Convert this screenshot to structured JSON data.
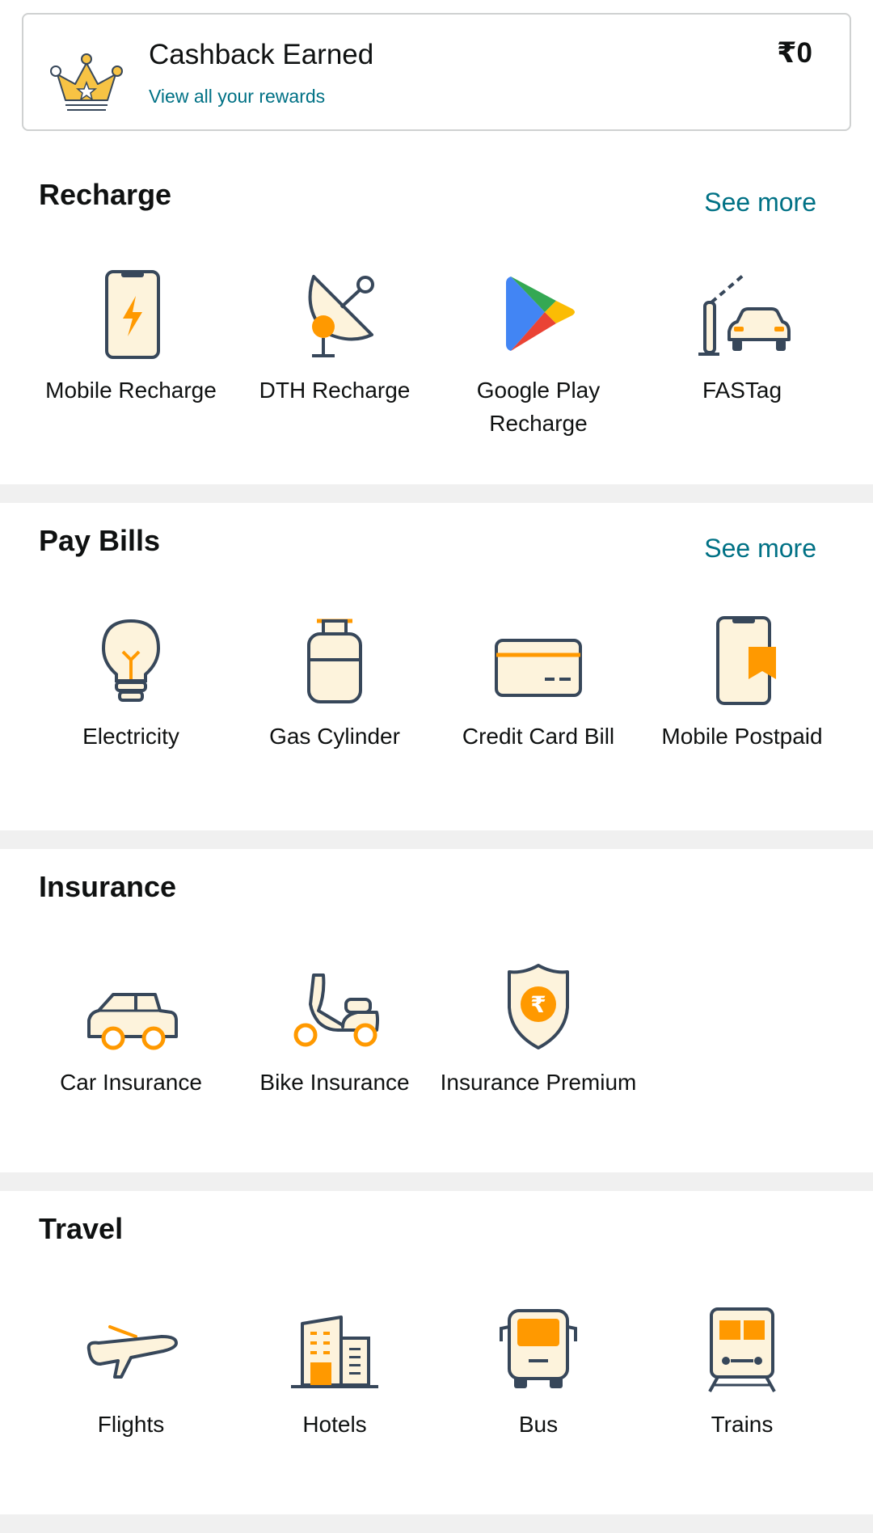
{
  "cashback": {
    "title": "Cashback Earned",
    "link": "View all your rewards",
    "amount": "₹0"
  },
  "recharge": {
    "title": "Recharge",
    "see_more": "See more",
    "items": [
      {
        "label": "Mobile Recharge",
        "icon": "mobile-recharge-icon"
      },
      {
        "label": "DTH Recharge",
        "icon": "satellite-dish-icon"
      },
      {
        "label": "Google Play Recharge",
        "icon": "google-play-icon"
      },
      {
        "label": "FASTag",
        "icon": "toll-car-icon"
      }
    ]
  },
  "pay_bills": {
    "title": "Pay Bills",
    "see_more": "See more",
    "items": [
      {
        "label": "Electricity",
        "icon": "bulb-icon"
      },
      {
        "label": "Gas Cylinder",
        "icon": "gas-cylinder-icon"
      },
      {
        "label": "Credit Card Bill",
        "icon": "credit-card-icon"
      },
      {
        "label": "Mobile Postpaid",
        "icon": "mobile-postpaid-icon"
      }
    ]
  },
  "insurance": {
    "title": "Insurance",
    "items": [
      {
        "label": "Car Insurance",
        "icon": "car-icon"
      },
      {
        "label": "Bike Insurance",
        "icon": "scooter-icon"
      },
      {
        "label": "Insurance Premium",
        "icon": "shield-rupee-icon"
      }
    ]
  },
  "travel": {
    "title": "Travel",
    "items": [
      {
        "label": "Flights",
        "icon": "airplane-icon"
      },
      {
        "label": "Hotels",
        "icon": "hotel-building-icon"
      },
      {
        "label": "Bus",
        "icon": "bus-icon"
      },
      {
        "label": "Trains",
        "icon": "train-icon"
      }
    ]
  },
  "colors": {
    "link": "#007185",
    "icon_stroke": "#37475a",
    "icon_fill": "#fdf3dc",
    "accent_orange": "#ff9900"
  }
}
